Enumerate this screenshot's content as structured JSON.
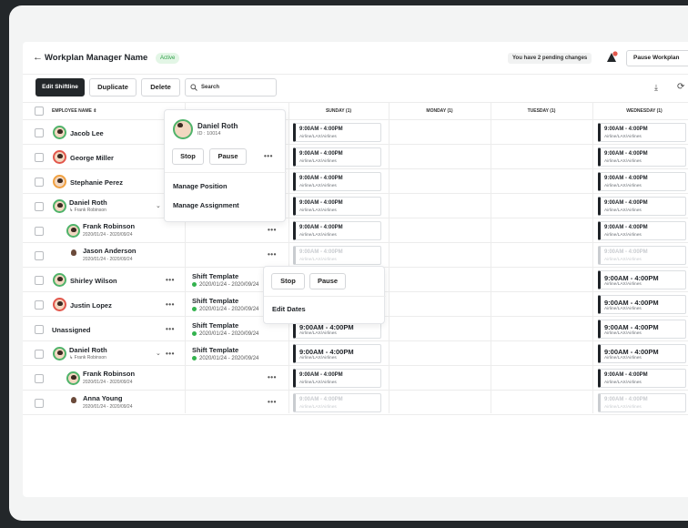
{
  "header": {
    "title": "Workplan Manager Name",
    "status": "Active",
    "pending": "You have 2 pending changes",
    "pause_label": "Pause Workplan"
  },
  "toolbar": {
    "edit_shiftline": "Edit Shiftline",
    "duplicate": "Duplicate",
    "delete": "Delete",
    "search_placeholder": "Search"
  },
  "columns": {
    "employee": "EMPLOYEE NAME",
    "sunday": "SUNDAY (1)",
    "monday": "MONDAY (1)",
    "tuesday": "TUESDAY (1)",
    "wednesday": "WEDNESDAY (1)"
  },
  "shift": {
    "time": "9:00AM - 4:00PM",
    "location": "Airline/LAX/Airlines"
  },
  "rows": [
    {
      "name": "Jacob Lee"
    },
    {
      "name": "George Miller"
    },
    {
      "name": "Stephanie Perez"
    },
    {
      "name": "Daniel Roth",
      "sub": "↳ Frank Robinson"
    },
    {
      "name": "Frank Robinson",
      "sub": "2020/01/24 - 2020/09/24"
    },
    {
      "name": "Jason Anderson",
      "sub": "2020/01/24 - 2020/09/24"
    },
    {
      "name": "Shirley Wilson",
      "template": "Shift Template",
      "template_dates": "2020/01/24 - 2020/09/24"
    },
    {
      "name": "Justin Lopez",
      "template": "Shift Template",
      "template_dates": "2020/01/24 - 2020/09/24"
    },
    {
      "name": "Unassigned",
      "template": "Shift Template",
      "template_dates": "2020/01/24 - 2020/09/24"
    },
    {
      "name": "Daniel Roth",
      "sub": "↳ Frank Robinson",
      "template": "Shift Template",
      "template_dates": "2020/01/24 - 2020/09/24"
    },
    {
      "name": "Frank Robinson",
      "sub": "2020/01/24 - 2020/09/24"
    },
    {
      "name": "Anna Young",
      "sub": "2020/01/24 - 2020/09/24"
    }
  ],
  "popover_employee": {
    "name": "Daniel Roth",
    "id": "ID : 10014",
    "stop": "Stop",
    "pause": "Pause",
    "manage_position": "Manage Position",
    "manage_assignment": "Manage Assignment"
  },
  "popover_template": {
    "stop": "Stop",
    "pause": "Pause",
    "edit_dates": "Edit Dates"
  },
  "icons": {
    "back": "arrow-left-icon",
    "alert": "alert-bell-icon",
    "download": "download-icon",
    "refresh": "refresh-icon",
    "search": "search-icon"
  },
  "colors": {
    "active_badge": "#2e9e47",
    "primary_button": "#23272a",
    "template_dot": "#33b24e"
  }
}
